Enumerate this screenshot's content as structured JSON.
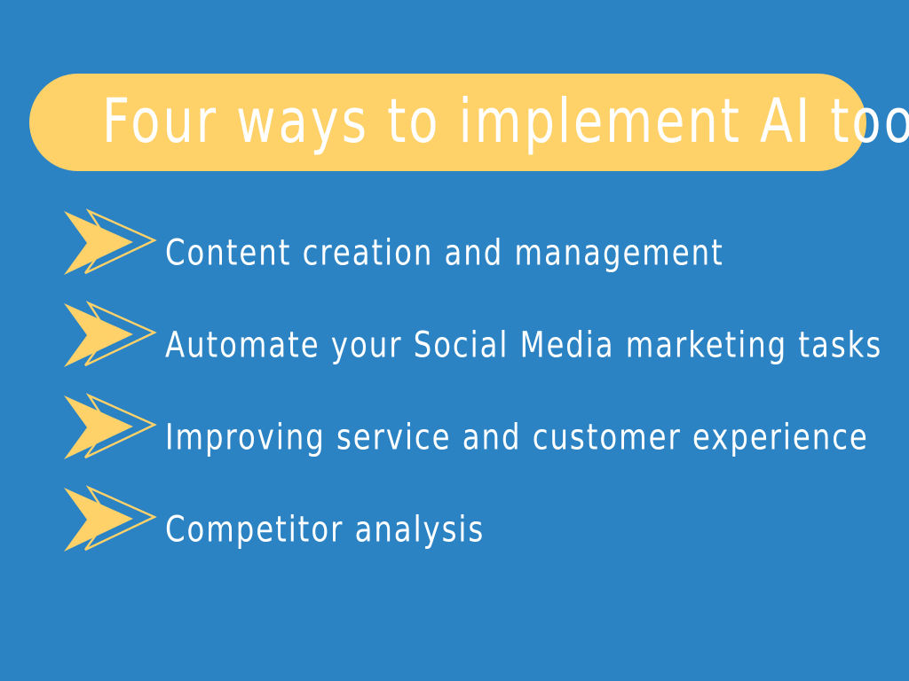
{
  "slide": {
    "background_color": "#2B83C4",
    "accent_color": "#FFD169",
    "text_color": "#FFFFFF"
  },
  "title": {
    "text": "Four ways to implement AI tools",
    "banner_color": "#FFD169",
    "text_color": "#FFFFFF"
  },
  "bullets": [
    {
      "marker_icon": "double-chevron-arrow-icon",
      "text": "Content creation and management"
    },
    {
      "marker_icon": "double-chevron-arrow-icon",
      "text": "Automate your Social Media marketing tasks"
    },
    {
      "marker_icon": "double-chevron-arrow-icon",
      "text": "Improving service and customer experience"
    },
    {
      "marker_icon": "double-chevron-arrow-icon",
      "text": "Competitor analysis"
    }
  ]
}
